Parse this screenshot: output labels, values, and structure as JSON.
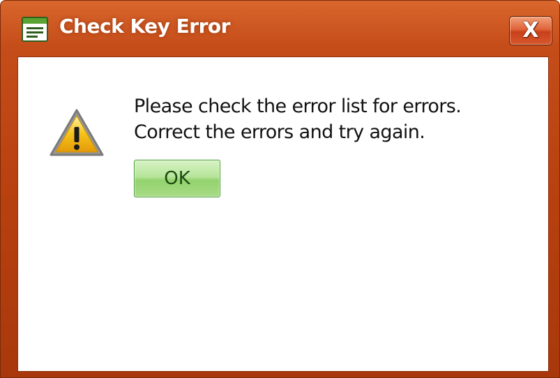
{
  "window": {
    "title": "Check Key Error",
    "close_glyph": "X",
    "icon": "app-window-icon"
  },
  "dialog": {
    "icon": "warning-icon",
    "message_line1": "Please check the error list for errors.",
    "message_line2": "Correct the errors and try again.",
    "ok_label": "OK"
  },
  "colors": {
    "titlebar": "#b8410f",
    "close_button": "#d8582e",
    "ok_button": "#a8dc86",
    "warning_fill": "#f6c21a"
  }
}
